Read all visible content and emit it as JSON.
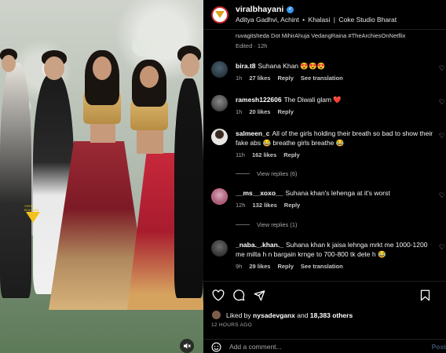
{
  "header": {
    "username": "viralbhayani",
    "sub_parts": [
      "Aditya Gadhvi, Achint",
      "Khalasi",
      "Coke Studio Bharat"
    ],
    "sep": "•",
    "sep2": "|",
    "verified_mark": "✓"
  },
  "caption": {
    "tail": "ruvagitsheda Dot MihirAhuja VedangRaina #TheArchiesOnNetflix",
    "edited": "Edited · 12h"
  },
  "comments": [
    {
      "user": "bira.t8",
      "text": "Suhana Khan 😍😍😍",
      "time": "1h",
      "likes": "27 likes",
      "reply": "Reply",
      "extra": "See translation",
      "avatar_color": "#2a3c48"
    },
    {
      "user": "ramesh122606",
      "text": "The Diwali glam ❤️",
      "time": "1h",
      "likes": "20 likes",
      "reply": "Reply",
      "extra": "",
      "avatar_color": "#444"
    },
    {
      "user": "salmeen_c",
      "text": "All of the girls holding their breath so bad to show their fake abs 😂 breathe girls breathe 😂",
      "time": "11h",
      "likes": "162 likes",
      "reply": "Reply",
      "extra": "",
      "avatar_color": "#d8d8d8",
      "view_replies": "View replies (6)"
    },
    {
      "user": "__ms__xoxo__",
      "text": "Suhana khan's lehenga at it's worst",
      "time": "12h",
      "likes": "132 likes",
      "reply": "Reply",
      "extra": "",
      "avatar_color": "#b35a7b",
      "view_replies": "View replies (1)"
    },
    {
      "user": "_naba._.khan._",
      "text": "Suhana khan k jaisa lehnga mrkt me 1000-1200 me milta h n bargain krnge to 700-800 tk dete h 😂",
      "time": "9h",
      "likes": "29 likes",
      "reply": "Reply",
      "extra": "See translation",
      "avatar_color": "#333"
    }
  ],
  "actions": {
    "liked_by_prefix": "Liked by",
    "liked_by_user": "nysadevganx",
    "liked_and": "and",
    "liked_others": "18,383 others",
    "time_ago": "12 HOURS AGO",
    "add_comment_placeholder": "Add a comment...",
    "post_label": "Post"
  },
  "media": {
    "watermark_text": "VIRAL BHAYANI"
  },
  "colors": {
    "accent_blue": "#3797f0",
    "heart_red": "#ed4956",
    "brand_gold": "#f2c21b"
  }
}
